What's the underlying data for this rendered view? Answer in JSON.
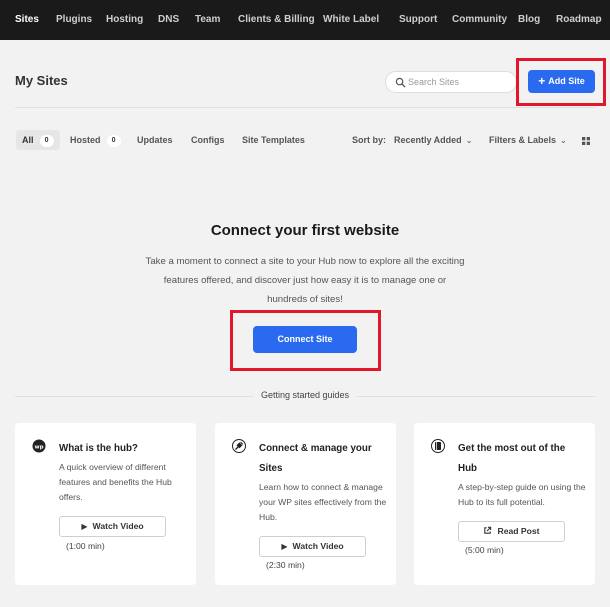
{
  "nav": {
    "items": [
      "Sites",
      "Plugins",
      "Hosting",
      "DNS",
      "Team",
      "Clients & Billing",
      "White Label",
      "Support",
      "Community",
      "Blog",
      "Roadmap"
    ]
  },
  "header": {
    "title": "My Sites",
    "search_placeholder": "Search Sites",
    "add_site_label": "Add Site"
  },
  "tabs": [
    {
      "label": "All",
      "count": "0"
    },
    {
      "label": "Hosted",
      "count": "0"
    },
    {
      "label": "Updates"
    },
    {
      "label": "Configs"
    },
    {
      "label": "Site Templates"
    }
  ],
  "sort": {
    "label": "Sort by:",
    "value": "Recently Added",
    "filters_label": "Filters & Labels"
  },
  "empty": {
    "title": "Connect your first website",
    "description": "Take a moment to connect a site to your Hub now to explore all the exciting features offered, and discover just how easy it is to manage one or hundreds of sites!",
    "connect_label": "Connect Site"
  },
  "guides": {
    "label": "Getting started guides",
    "cards": [
      {
        "icon": "hub-logo-icon",
        "title": "What is the hub?",
        "description": "A quick overview of different features and benefits the Hub offers.",
        "button": "Watch Video",
        "button_icon": "play-icon",
        "duration": "(1:00 min)"
      },
      {
        "icon": "plug-icon",
        "title": "Connect & manage your Sites",
        "description": "Learn how to connect & manage your WP sites effectively from the Hub.",
        "button": "Watch Video",
        "button_icon": "play-icon",
        "duration": "(2:30 min)"
      },
      {
        "icon": "book-icon",
        "title": "Get the most out of the Hub",
        "description": "A step-by-step guide on using the Hub to its full potential.",
        "button": "Read Post",
        "button_icon": "external-link-icon",
        "duration": "(5:00 min)"
      }
    ]
  },
  "colors": {
    "accent": "#2a6af0",
    "highlight": "#e3172b",
    "nav_bg": "#1a1a1a"
  }
}
